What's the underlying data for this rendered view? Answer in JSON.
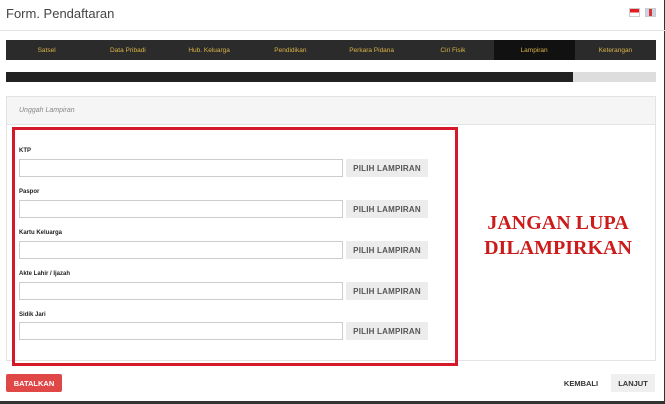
{
  "header": {
    "title": "Form. Pendaftaran"
  },
  "nav": {
    "items": [
      "Satsel",
      "Data Pribadi",
      "Hub. Keluarga",
      "Pendidikan",
      "Perkara Pidana",
      "Ciri Fisik",
      "Lampiran",
      "Keterangan"
    ],
    "active_index": 6
  },
  "progress": {
    "fraction": 0.873
  },
  "panel": {
    "title": "Unggah Lampiran"
  },
  "fields": [
    {
      "label": "KTP",
      "button": "PILIH LAMPIRAN"
    },
    {
      "label": "Paspor",
      "button": "PILIH LAMPIRAN"
    },
    {
      "label": "Kartu Keluarga",
      "button": "PILIH LAMPIRAN"
    },
    {
      "label": "Akte Lahir / Ijazah",
      "button": "PILIH LAMPIRAN"
    },
    {
      "label": "Sidik Jari",
      "button": "PILIH LAMPIRAN"
    }
  ],
  "annotation": {
    "line1": "JANGAN LUPA",
    "line2": "DILAMPIRKAN"
  },
  "footer": {
    "cancel": "BATALKAN",
    "back": "KEMBALI",
    "next": "LANJUT"
  },
  "colors": {
    "accent": "#d9b347",
    "cancel": "#e04848",
    "highlight": "#d6182b"
  }
}
